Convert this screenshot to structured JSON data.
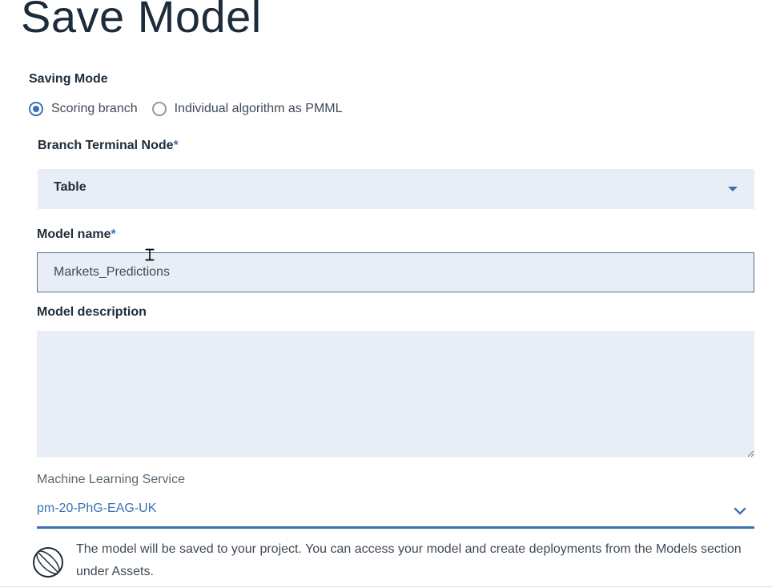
{
  "title": "Save Model",
  "saving_mode": {
    "label": "Saving Mode",
    "options": [
      {
        "label": "Scoring branch",
        "selected": true
      },
      {
        "label": "Individual algorithm as PMML",
        "selected": false
      }
    ]
  },
  "branch_terminal_node": {
    "label": "Branch Terminal Node",
    "required_mark": "*",
    "value": "Table"
  },
  "model_name": {
    "label": "Model name",
    "required_mark": "*",
    "value": "Markets_Predictions"
  },
  "model_description": {
    "label": "Model description",
    "value": ""
  },
  "ml_service": {
    "label": "Machine Learning Service",
    "value": "pm-20-PhG-EAG-UK"
  },
  "info": {
    "text": "The model will be saved to your project. You can access your model and create deployments from the Models section under Assets."
  },
  "icons": {
    "dropdown": "caret-down-icon",
    "ml_dropdown": "chevron-down-icon",
    "info": "project-globe-icon",
    "cursor": "text-cursor-icon"
  },
  "colors": {
    "accent": "#3d70b2",
    "field_background": "#e9eef6",
    "title_text": "#1d2b3a"
  }
}
